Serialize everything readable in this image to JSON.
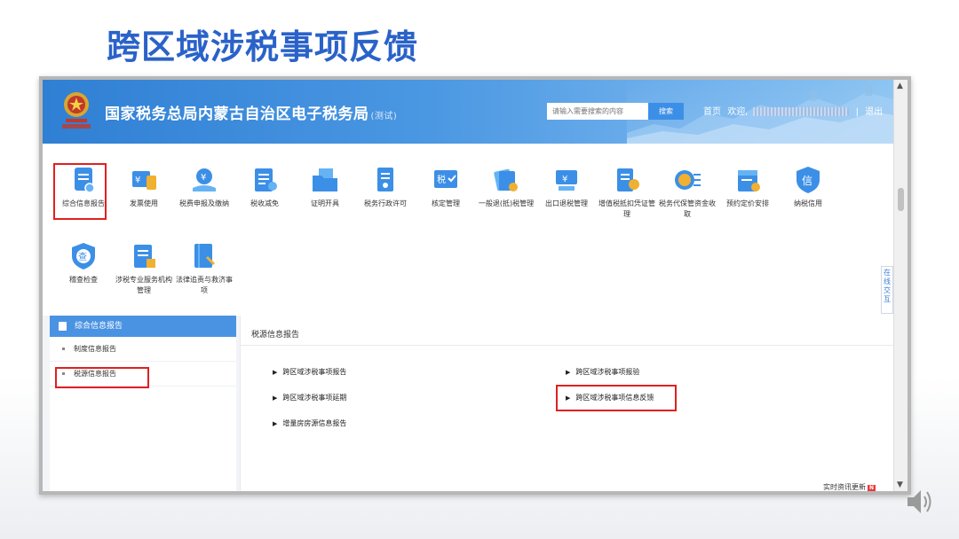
{
  "slide": {
    "title": "跨区域涉税事项反馈"
  },
  "header": {
    "site_name": "国家税务总局内蒙古自治区电子税务局",
    "site_tag": "(测试)",
    "search_placeholder": "请输入需要搜索的内容",
    "search_button": "搜索",
    "home_link": "首页",
    "welcome": "欢迎,",
    "separator": "|",
    "logout": "退出"
  },
  "icons": [
    {
      "label": "综合信息报告",
      "icon": "report-icon",
      "color": "#3c8fe6"
    },
    {
      "label": "发票使用",
      "icon": "invoice-icon",
      "color": "#3c8fe6"
    },
    {
      "label": "税费申报及缴纳",
      "icon": "declare-icon",
      "color": "#3c8fe6"
    },
    {
      "label": "税收减免",
      "icon": "tax-relief-icon",
      "color": "#3c8fe6"
    },
    {
      "label": "证明开具",
      "icon": "certificate-folder-icon",
      "color": "#3c8fe6"
    },
    {
      "label": "税务行政许可",
      "icon": "license-icon",
      "color": "#3c8fe6"
    },
    {
      "label": "核定管理",
      "icon": "approval-icon",
      "color": "#3c8fe6"
    },
    {
      "label": "一般退(抵)税管理",
      "icon": "refund-icon",
      "color": "#3c8fe6"
    },
    {
      "label": "出口退税管理",
      "icon": "export-refund-icon",
      "color": "#3c8fe6"
    },
    {
      "label": "增值税抵扣凭证管理",
      "icon": "vat-deduction-icon",
      "color": "#3c8fe6"
    },
    {
      "label": "税务代保管资金收取",
      "icon": "funds-icon",
      "color": "#3c8fe6"
    },
    {
      "label": "预约定价安排",
      "icon": "pricing-icon",
      "color": "#3c8fe6"
    },
    {
      "label": "纳税信用",
      "icon": "credit-shield-icon",
      "color": "#3c8fe6"
    },
    {
      "label": "稽查检查",
      "icon": "inspection-shield-icon",
      "color": "#3c8fe6"
    },
    {
      "label": "涉税专业服务机构管理",
      "icon": "agency-icon",
      "color": "#3c8fe6"
    },
    {
      "label": "法律追责与救济事项",
      "icon": "law-book-icon",
      "color": "#3c8fe6"
    }
  ],
  "float_tab": "在线交互",
  "left_panel": {
    "header": "综合信息报告",
    "items": [
      "制度信息报告",
      "税源信息报告"
    ]
  },
  "main_panel": {
    "title": "税源信息报告",
    "links": [
      "跨区域涉税事项报告",
      "跨区域涉税事项报验",
      "跨区域涉税事项延期",
      "跨区域涉税事项信息反馈",
      "增量房房源信息报告"
    ]
  },
  "news_tag": {
    "label": "实时资讯更新",
    "badge": "N"
  },
  "colors": {
    "highlight": "#e02020",
    "brand": "#2a62c9",
    "banner": "#3c8fe6"
  }
}
